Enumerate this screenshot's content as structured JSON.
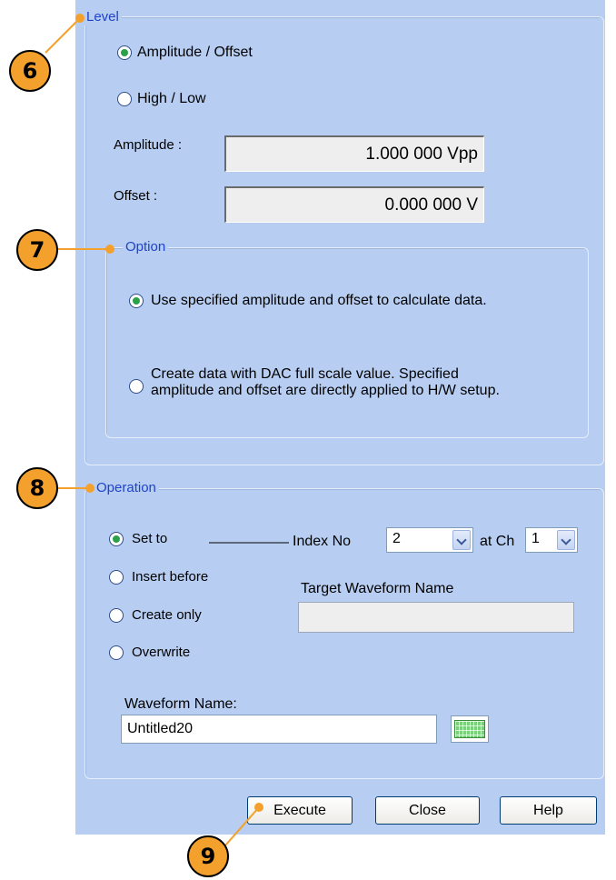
{
  "level": {
    "legend": "Level",
    "mode_options": [
      {
        "label": "Amplitude / Offset",
        "selected": true
      },
      {
        "label": "High / Low",
        "selected": false
      }
    ],
    "amplitude_label": "Amplitude :",
    "amplitude_value": "1.000 000 Vpp",
    "offset_label": "Offset :",
    "offset_value": "0.000 000 V"
  },
  "option": {
    "legend": "Option",
    "use_specified": {
      "label": "Use specified amplitude and offset to calculate data.",
      "selected": true
    },
    "dac_full_scale": {
      "line1": "Create data with DAC full scale value. Specified",
      "line2": "amplitude and offset are directly applied to H/W setup.",
      "selected": false
    }
  },
  "operation": {
    "legend": "Operation",
    "modes": [
      {
        "label": "Set to",
        "selected": true
      },
      {
        "label": "Insert before",
        "selected": false
      },
      {
        "label": "Create only",
        "selected": false
      },
      {
        "label": "Overwrite",
        "selected": false
      }
    ],
    "index_label": "Index No",
    "index_value": "2",
    "channel_label": "at Ch",
    "channel_value": "1",
    "target_label": "Target Waveform Name",
    "target_value": "",
    "waveform_name_label": "Waveform Name:",
    "waveform_name_value": "Untitled20",
    "keyboard_icon": "keyboard-icon"
  },
  "buttons": {
    "execute": "Execute",
    "close": "Close",
    "help": "Help"
  },
  "callouts": [
    "6",
    "7",
    "8",
    "9"
  ],
  "colors": {
    "panel_bg": "#b7cef2",
    "legend_text": "#1f43c8",
    "callout_fill": "#f3a12c",
    "radio_selected": "#2aa14a"
  }
}
